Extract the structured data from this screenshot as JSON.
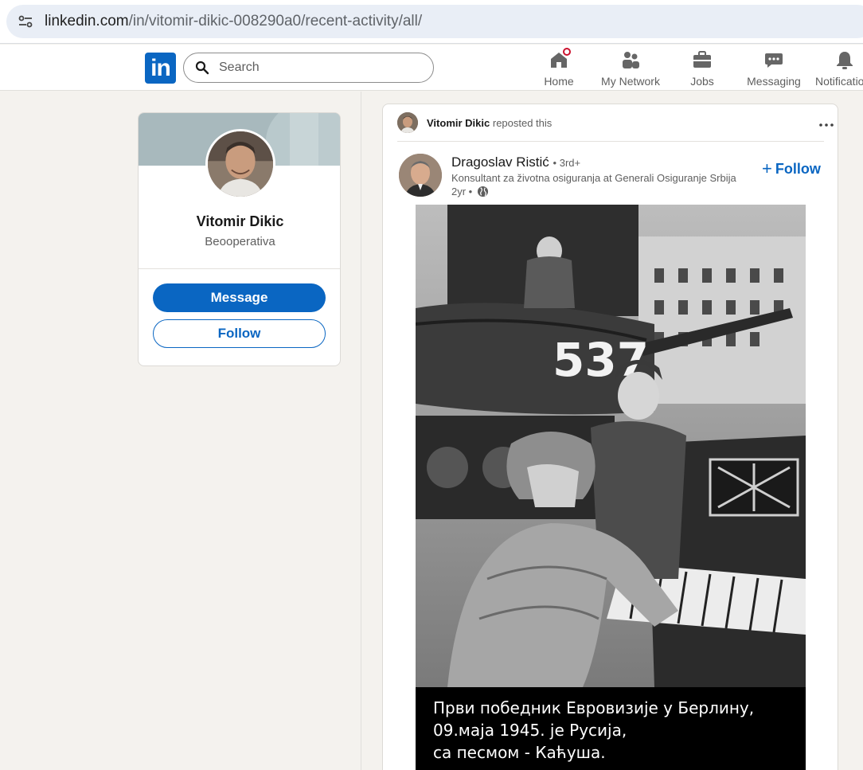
{
  "browser": {
    "url_host": "linkedin.com",
    "url_path": "/in/vitomir-dikic-008290a0/recent-activity/all/"
  },
  "nav": {
    "logo_text": "in",
    "search_placeholder": "Search",
    "items": [
      {
        "label": "Home",
        "icon": "home-icon",
        "has_notification": true
      },
      {
        "label": "My Network",
        "icon": "network-icon"
      },
      {
        "label": "Jobs",
        "icon": "briefcase-icon"
      },
      {
        "label": "Messaging",
        "icon": "chat-icon"
      },
      {
        "label": "Notifications",
        "icon": "bell-icon"
      }
    ]
  },
  "profile_card": {
    "name": "Vitomir Dikic",
    "headline": "Beooperativa",
    "message_label": "Message",
    "follow_label": "Follow"
  },
  "post": {
    "reposter_name": "Vitomir Dikic",
    "repost_suffix": "reposted this",
    "author_name": "Dragoslav Ristić",
    "author_degree": "• 3rd+",
    "author_headline": "Konsultant za životna osiguranja at Generali Osiguranje Srbija",
    "time": "2yr •",
    "follow_label": "Follow",
    "image_caption": [
      "Први победник Евровизије у Берлину,",
      "09.маја 1945. је Русија,",
      "са песмом - Каћуша."
    ],
    "image_tank_number": "537"
  },
  "colors": {
    "brand_blue": "#0a66c2",
    "page_bg": "#f4f2ee",
    "notification_red": "#cb112d"
  }
}
